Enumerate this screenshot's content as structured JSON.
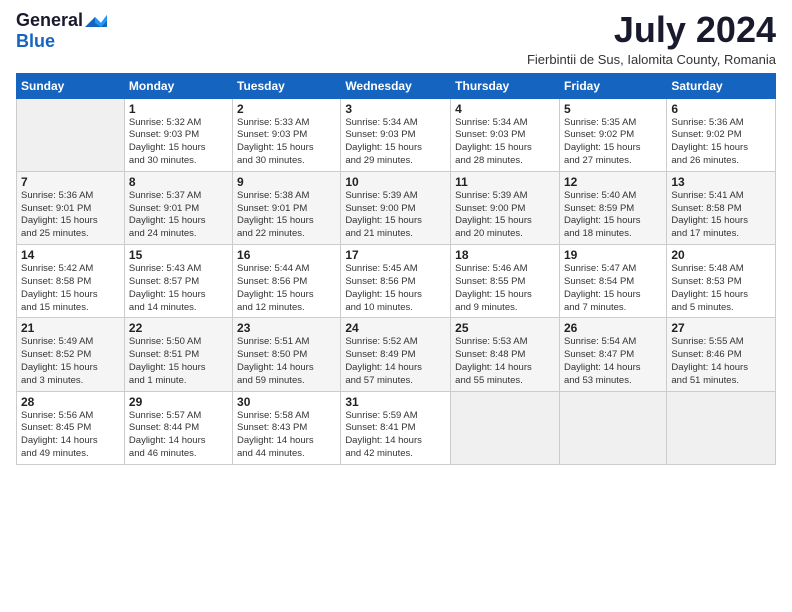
{
  "logo": {
    "general": "General",
    "blue": "Blue"
  },
  "header": {
    "month": "July 2024",
    "location": "Fierbintii de Sus, Ialomita County, Romania"
  },
  "weekdays": [
    "Sunday",
    "Monday",
    "Tuesday",
    "Wednesday",
    "Thursday",
    "Friday",
    "Saturday"
  ],
  "weeks": [
    [
      {
        "day": "",
        "info": ""
      },
      {
        "day": "1",
        "info": "Sunrise: 5:32 AM\nSunset: 9:03 PM\nDaylight: 15 hours\nand 30 minutes."
      },
      {
        "day": "2",
        "info": "Sunrise: 5:33 AM\nSunset: 9:03 PM\nDaylight: 15 hours\nand 30 minutes."
      },
      {
        "day": "3",
        "info": "Sunrise: 5:34 AM\nSunset: 9:03 PM\nDaylight: 15 hours\nand 29 minutes."
      },
      {
        "day": "4",
        "info": "Sunrise: 5:34 AM\nSunset: 9:03 PM\nDaylight: 15 hours\nand 28 minutes."
      },
      {
        "day": "5",
        "info": "Sunrise: 5:35 AM\nSunset: 9:02 PM\nDaylight: 15 hours\nand 27 minutes."
      },
      {
        "day": "6",
        "info": "Sunrise: 5:36 AM\nSunset: 9:02 PM\nDaylight: 15 hours\nand 26 minutes."
      }
    ],
    [
      {
        "day": "7",
        "info": "Sunrise: 5:36 AM\nSunset: 9:01 PM\nDaylight: 15 hours\nand 25 minutes."
      },
      {
        "day": "8",
        "info": "Sunrise: 5:37 AM\nSunset: 9:01 PM\nDaylight: 15 hours\nand 24 minutes."
      },
      {
        "day": "9",
        "info": "Sunrise: 5:38 AM\nSunset: 9:01 PM\nDaylight: 15 hours\nand 22 minutes."
      },
      {
        "day": "10",
        "info": "Sunrise: 5:39 AM\nSunset: 9:00 PM\nDaylight: 15 hours\nand 21 minutes."
      },
      {
        "day": "11",
        "info": "Sunrise: 5:39 AM\nSunset: 9:00 PM\nDaylight: 15 hours\nand 20 minutes."
      },
      {
        "day": "12",
        "info": "Sunrise: 5:40 AM\nSunset: 8:59 PM\nDaylight: 15 hours\nand 18 minutes."
      },
      {
        "day": "13",
        "info": "Sunrise: 5:41 AM\nSunset: 8:58 PM\nDaylight: 15 hours\nand 17 minutes."
      }
    ],
    [
      {
        "day": "14",
        "info": "Sunrise: 5:42 AM\nSunset: 8:58 PM\nDaylight: 15 hours\nand 15 minutes."
      },
      {
        "day": "15",
        "info": "Sunrise: 5:43 AM\nSunset: 8:57 PM\nDaylight: 15 hours\nand 14 minutes."
      },
      {
        "day": "16",
        "info": "Sunrise: 5:44 AM\nSunset: 8:56 PM\nDaylight: 15 hours\nand 12 minutes."
      },
      {
        "day": "17",
        "info": "Sunrise: 5:45 AM\nSunset: 8:56 PM\nDaylight: 15 hours\nand 10 minutes."
      },
      {
        "day": "18",
        "info": "Sunrise: 5:46 AM\nSunset: 8:55 PM\nDaylight: 15 hours\nand 9 minutes."
      },
      {
        "day": "19",
        "info": "Sunrise: 5:47 AM\nSunset: 8:54 PM\nDaylight: 15 hours\nand 7 minutes."
      },
      {
        "day": "20",
        "info": "Sunrise: 5:48 AM\nSunset: 8:53 PM\nDaylight: 15 hours\nand 5 minutes."
      }
    ],
    [
      {
        "day": "21",
        "info": "Sunrise: 5:49 AM\nSunset: 8:52 PM\nDaylight: 15 hours\nand 3 minutes."
      },
      {
        "day": "22",
        "info": "Sunrise: 5:50 AM\nSunset: 8:51 PM\nDaylight: 15 hours\nand 1 minute."
      },
      {
        "day": "23",
        "info": "Sunrise: 5:51 AM\nSunset: 8:50 PM\nDaylight: 14 hours\nand 59 minutes."
      },
      {
        "day": "24",
        "info": "Sunrise: 5:52 AM\nSunset: 8:49 PM\nDaylight: 14 hours\nand 57 minutes."
      },
      {
        "day": "25",
        "info": "Sunrise: 5:53 AM\nSunset: 8:48 PM\nDaylight: 14 hours\nand 55 minutes."
      },
      {
        "day": "26",
        "info": "Sunrise: 5:54 AM\nSunset: 8:47 PM\nDaylight: 14 hours\nand 53 minutes."
      },
      {
        "day": "27",
        "info": "Sunrise: 5:55 AM\nSunset: 8:46 PM\nDaylight: 14 hours\nand 51 minutes."
      }
    ],
    [
      {
        "day": "28",
        "info": "Sunrise: 5:56 AM\nSunset: 8:45 PM\nDaylight: 14 hours\nand 49 minutes."
      },
      {
        "day": "29",
        "info": "Sunrise: 5:57 AM\nSunset: 8:44 PM\nDaylight: 14 hours\nand 46 minutes."
      },
      {
        "day": "30",
        "info": "Sunrise: 5:58 AM\nSunset: 8:43 PM\nDaylight: 14 hours\nand 44 minutes."
      },
      {
        "day": "31",
        "info": "Sunrise: 5:59 AM\nSunset: 8:41 PM\nDaylight: 14 hours\nand 42 minutes."
      },
      {
        "day": "",
        "info": ""
      },
      {
        "day": "",
        "info": ""
      },
      {
        "day": "",
        "info": ""
      }
    ]
  ]
}
